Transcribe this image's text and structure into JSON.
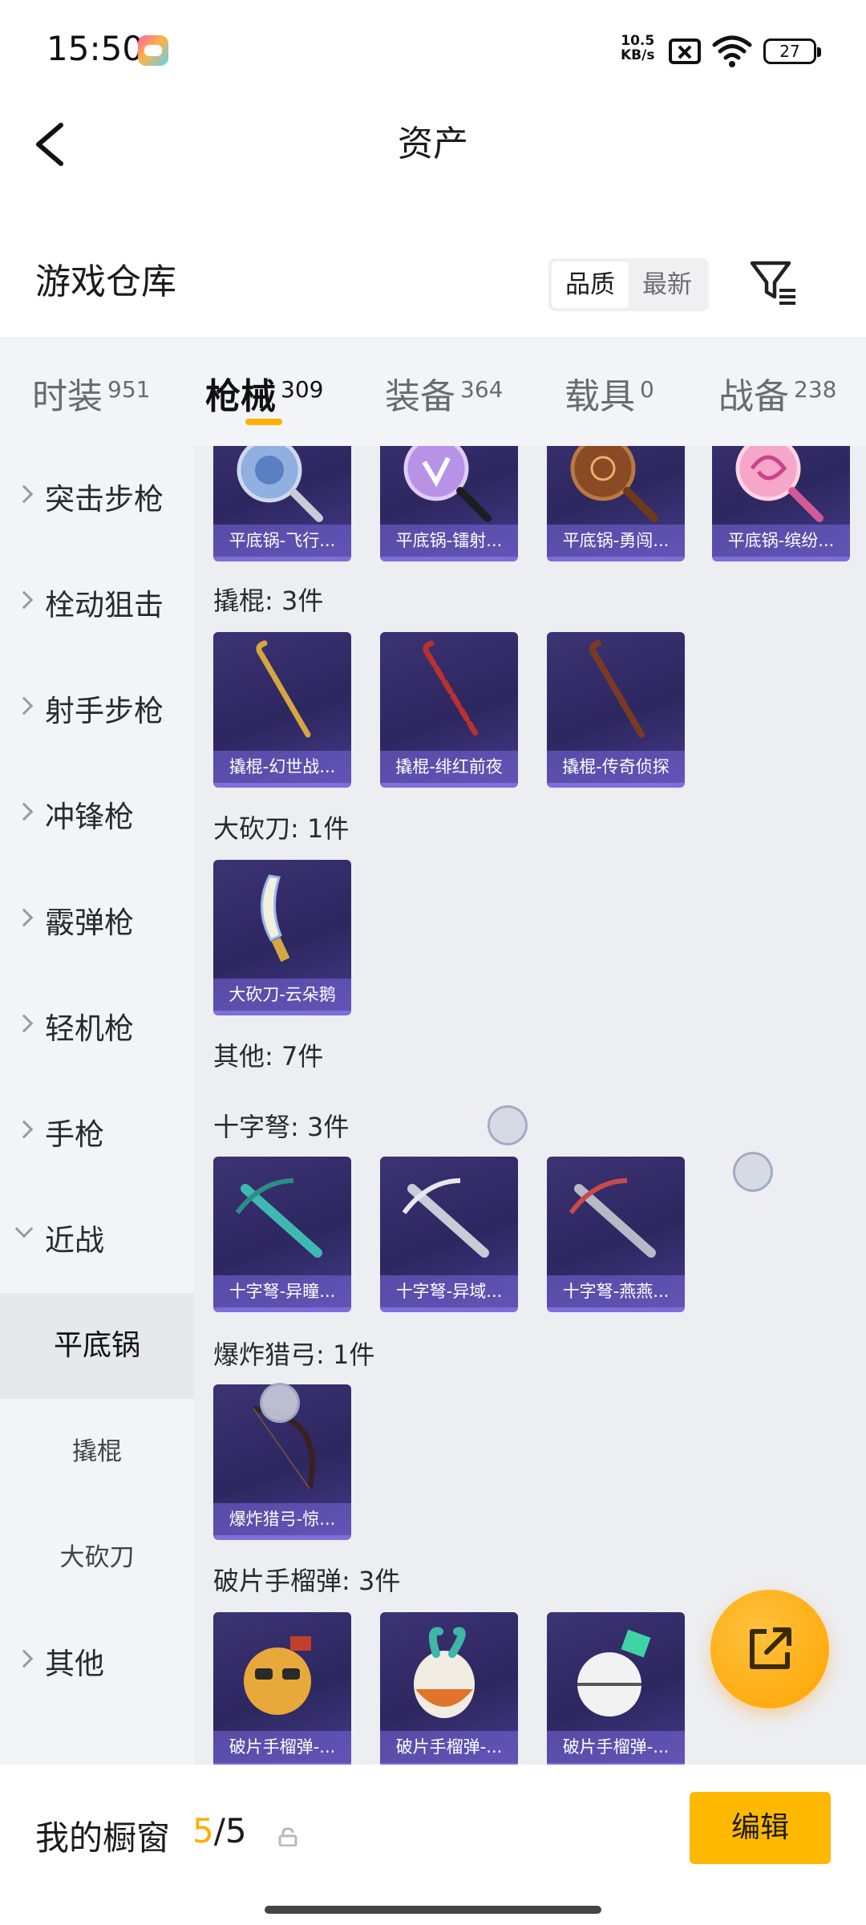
{
  "status_bar": {
    "time": "15:50",
    "net_speed_value": "10.5",
    "net_speed_unit": "KB/s",
    "battery": "27",
    "icons": [
      "game-app-icon",
      "no-sim-icon",
      "wifi-icon",
      "battery-icon"
    ]
  },
  "header": {
    "title": "资产",
    "back_icon": "chevron-left-icon"
  },
  "repo": {
    "title": "游戏仓库",
    "sort_options": [
      "品质",
      "最新"
    ],
    "selected_sort": "品质",
    "filter_icon": "filter-icon"
  },
  "tabs": [
    {
      "label": "时装",
      "count": "951"
    },
    {
      "label": "枪械",
      "count": "309"
    },
    {
      "label": "装备",
      "count": "364"
    },
    {
      "label": "载具",
      "count": "0"
    },
    {
      "label": "战备",
      "count": "238"
    }
  ],
  "active_tab": "枪械",
  "sidebar": {
    "items": [
      {
        "label": "突击步枪"
      },
      {
        "label": "栓动狙击"
      },
      {
        "label": "射手步枪"
      },
      {
        "label": "冲锋枪"
      },
      {
        "label": "霰弹枪"
      },
      {
        "label": "轻机枪"
      },
      {
        "label": "手枪"
      },
      {
        "label": "近战"
      },
      {
        "label": "其他"
      }
    ],
    "melee_sub": [
      {
        "label": "平底锅"
      },
      {
        "label": "撬棍"
      },
      {
        "label": "大砍刀"
      }
    ],
    "active_sub": "平底锅"
  },
  "groups": {
    "pan": {
      "items": [
        "平底锅-飞行...",
        "平底锅-镭射...",
        "平底锅-勇闯...",
        "平底锅-缤纷..."
      ]
    },
    "crowbar": {
      "label": "撬棍: 3件",
      "items": [
        "撬棍-幻世战...",
        "撬棍-绯红前夜",
        "撬棍-传奇侦探"
      ]
    },
    "machete": {
      "label": "大砍刀: 1件",
      "items": [
        "大砍刀-云朵鹅"
      ]
    },
    "other": {
      "label": "其他: 7件"
    },
    "crossbow": {
      "label": "十字弩: 3件",
      "items": [
        "十字弩-异瞳...",
        "十字弩-异域...",
        "十字弩-燕燕..."
      ]
    },
    "bow": {
      "label": "爆炸猎弓: 1件",
      "items": [
        "爆炸猎弓-惊..."
      ]
    },
    "grenade": {
      "label": "破片手榴弹: 3件",
      "items": [
        "破片手榴弹-...",
        "破片手榴弹-...",
        "破片手榴弹-..."
      ]
    }
  },
  "fab_icon": "share-external-icon",
  "bottom_bar": {
    "label": "我的橱窗",
    "current": "5",
    "total": "/5",
    "lock_icon": "lock-icon",
    "edit_label": "编辑"
  },
  "colors": {
    "accent": "#ffb800",
    "card_bg": "#342c6c",
    "card_caption": "#7d6fd8",
    "panel_bg": "#eceef2"
  }
}
